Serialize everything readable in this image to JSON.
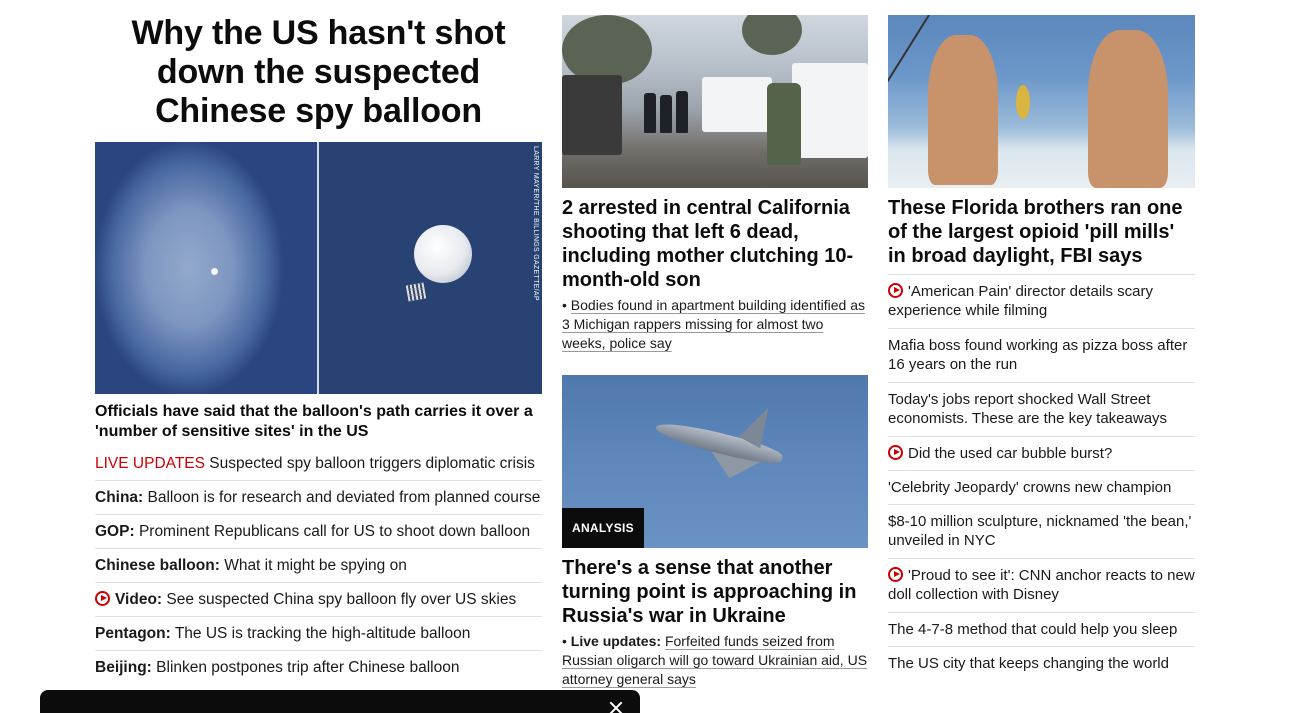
{
  "left": {
    "headline": "Why the US hasn't shot down the suspected Chinese spy balloon",
    "image_credit": "LARRY MAYER/THE BILLINGS GAZETTE/AP",
    "caption": "Officials have said that the balloon's path carries it over a 'number of sensitive sites' in the US",
    "items": [
      {
        "prefix": "LIVE UPDATES",
        "text": "Suspected spy balloon triggers diplomatic crisis"
      },
      {
        "prefix": "China:",
        "text": "Balloon is for research and deviated from planned course"
      },
      {
        "prefix": "GOP:",
        "text": "Prominent Republicans call for US to shoot down balloon"
      },
      {
        "prefix": "Chinese balloon:",
        "text": "What it might be spying on"
      },
      {
        "prefix": "Video:",
        "text": "See suspected China spy balloon fly over US skies"
      },
      {
        "prefix": "Pentagon:",
        "text": "The US is tracking the high-altitude balloon"
      },
      {
        "prefix": "Beijing:",
        "text": "Blinken postpones trip after Chinese balloon"
      }
    ]
  },
  "middle": {
    "story1": {
      "headline": "2 arrested in central California shooting that left 6 dead, including mother clutching 10-month-old son",
      "bullet": "•",
      "sub": "Bodies found in apartment building identified as 3 Michigan rappers missing for almost two weeks, police say"
    },
    "story2": {
      "badge": "ANALYSIS",
      "headline": "There's a sense that another turning point is approaching in Russia's war in Ukraine",
      "bullet": "•",
      "sub_prefix": "Live updates:",
      "sub": "Forfeited funds seized from Russian oligarch will go toward Ukrainian aid, US attorney general says"
    }
  },
  "right": {
    "headline": "These Florida brothers ran one of the largest opioid 'pill mills' in broad daylight, FBI says",
    "items": [
      {
        "text": "'American Pain' director details scary experience while filming",
        "video": true
      },
      {
        "text": "Mafia boss found working as pizza boss after 16 years on the run",
        "video": false
      },
      {
        "text": "Today's jobs report shocked Wall Street economists. These are the key takeaways",
        "video": false
      },
      {
        "text": "Did the used car bubble burst?",
        "video": true
      },
      {
        "text": "'Celebrity Jeopardy' crowns new champion",
        "video": false
      },
      {
        "text": "$8-10 million sculpture, nicknamed 'the bean,' unveiled in NYC",
        "video": false
      },
      {
        "text": "'Proud to see it': CNN anchor reacts to new doll collection with Disney",
        "video": true
      },
      {
        "text": "The 4-7-8 method that could help you sleep",
        "video": false
      },
      {
        "text": "The US city that keeps changing the world",
        "video": false
      }
    ]
  },
  "colors": {
    "live_red": "#cc0000",
    "text": "#0c0c0c",
    "badge_bg": "#0c0c0c"
  }
}
